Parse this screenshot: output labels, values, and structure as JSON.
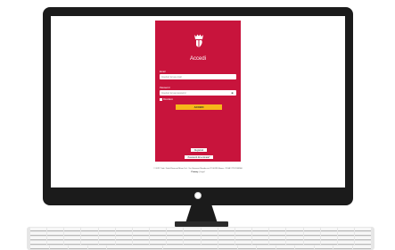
{
  "login": {
    "title": "Accedi",
    "email_label": "Email",
    "email_placeholder": "Inserisci la tua email",
    "password_label": "Password",
    "password_placeholder": "Inserisci la tua password",
    "remember_label": "Ricordami",
    "submit_label": "ACCEDI",
    "register_label": "Registrati",
    "forgot_label": "Password dimenticata?"
  },
  "footer": {
    "copyright": "© 2022 Tutti i Diritti Riservati Mixer S.r.l. Via Giovanni Randaccio 22 00195 Roma - P.IVA 17712245960",
    "privacy": "Privacy",
    "separator": "|",
    "legal": "Legal"
  },
  "colors": {
    "brand_red": "#c8143c",
    "button_yellow": "#f6b81a",
    "monitor": "#1b1b1b"
  }
}
